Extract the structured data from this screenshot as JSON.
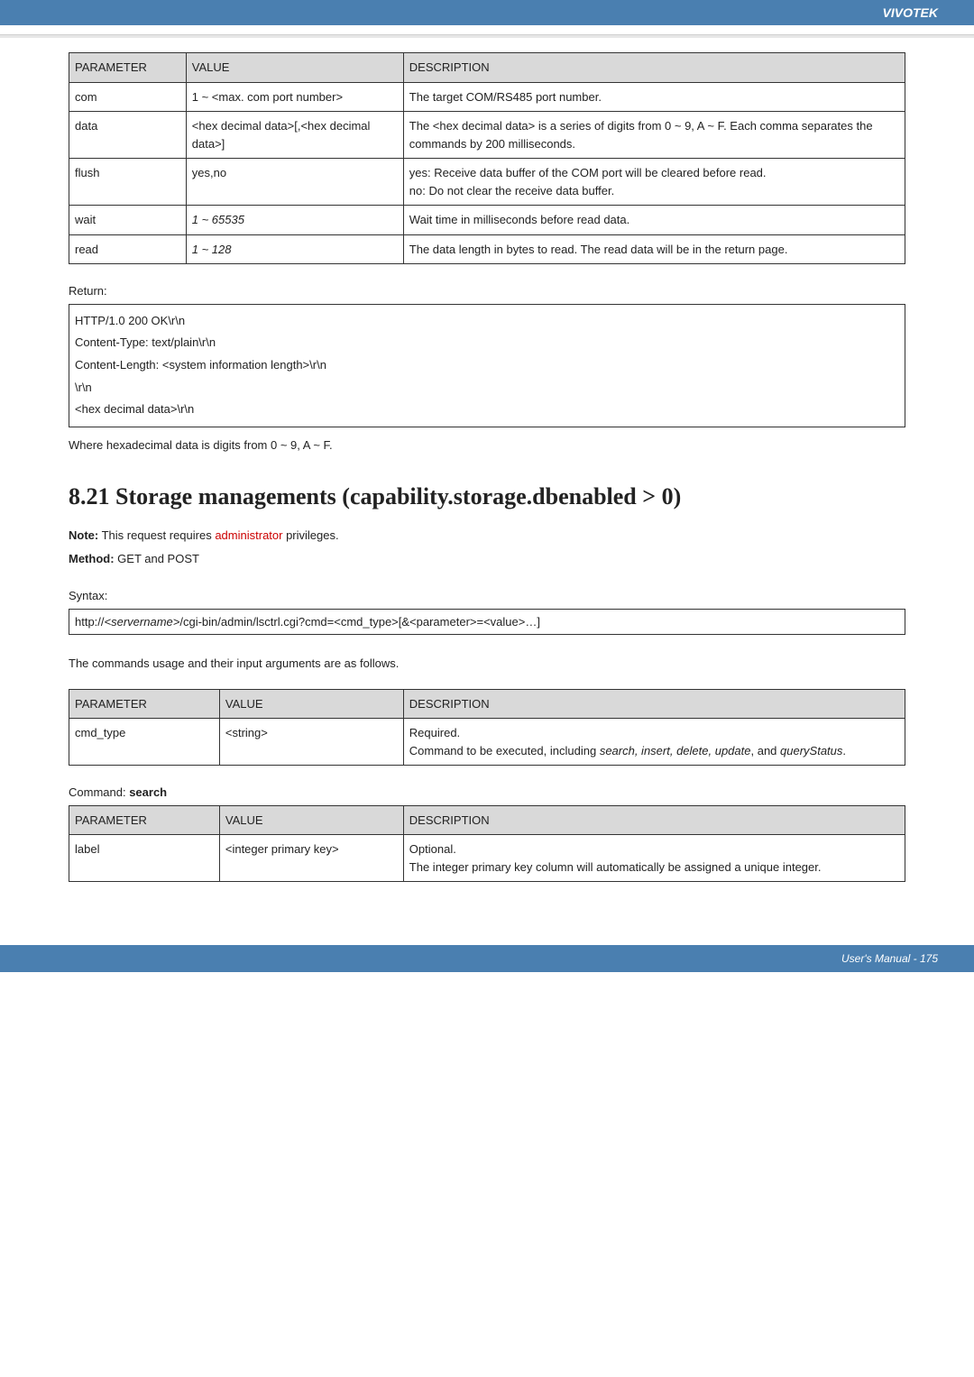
{
  "brand": "VIVOTEK",
  "table1": {
    "headers": [
      "PARAMETER",
      "VALUE",
      "DESCRIPTION"
    ],
    "rows": [
      {
        "p": "com",
        "v": "1 ~ <max. com port number>",
        "d": "The target COM/RS485 port number."
      },
      {
        "p": "data",
        "v": "<hex decimal data>[,<hex decimal data>]",
        "d": "The <hex decimal data> is a series of digits from 0 ~ 9, A ~ F. Each comma separates the commands by 200 milliseconds."
      },
      {
        "p": "flush",
        "v": "yes,no",
        "d": "yes: Receive data buffer of the COM port will be cleared before read.\nno: Do not clear the receive data buffer."
      },
      {
        "p": "wait",
        "v": "1 ~ 65535",
        "d": "Wait time in milliseconds before read data.",
        "vItalic": true
      },
      {
        "p": "read",
        "v": "1 ~ 128",
        "d": "The data length in bytes to read. The read data will be in the return page.",
        "vItalic": true
      }
    ]
  },
  "returnLabel": "Return:",
  "returnBox": [
    "HTTP/1.0 200 OK\\r\\n",
    "Content-Type: text/plain\\r\\n",
    "Content-Length: <system information length>\\r\\n",
    "\\r\\n",
    "<hex decimal data>\\r\\n"
  ],
  "hexNote": "Where hexadecimal data is digits from 0 ~ 9, A ~ F.",
  "sectionTitle": "8.21 Storage managements (capability.storage.dbenabled > 0)",
  "noteLabel": "Note:",
  "noteText1": " This request requires ",
  "noteAdmin": "administrator",
  "noteText2": " privileges.",
  "methodLabel": "Method:",
  "methodText": " GET and POST",
  "syntaxLabel": "Syntax:",
  "syntaxPrefix": "http://",
  "syntaxServer": "<servername>",
  "syntaxRest": "/cgi-bin/admin/lsctrl.cgi?cmd=<cmd_type>[&<parameter>=<value>…]",
  "usageLine": "The commands usage and their input arguments are as follows.",
  "table2": {
    "headers": [
      "PARAMETER",
      "VALUE",
      "DESCRIPTION"
    ],
    "rows": [
      {
        "p": "cmd_type",
        "v": "<string>",
        "d": "Required.\nCommand to be executed, including ",
        "dItalics": "search, insert, delete, update",
        "dMid": ", and ",
        "dItalics2": "queryStatus",
        "dEnd": "."
      }
    ]
  },
  "cmdLabelPrefix": "Command: ",
  "cmdLabelBold": "search",
  "table3": {
    "headers": [
      "PARAMETER",
      "VALUE",
      "DESCRIPTION"
    ],
    "rows": [
      {
        "p": "label",
        "v": "<integer primary key>",
        "d": "Optional.\nThe integer primary key column will automatically be assigned a unique integer."
      }
    ]
  },
  "footer": "User's Manual - 175"
}
